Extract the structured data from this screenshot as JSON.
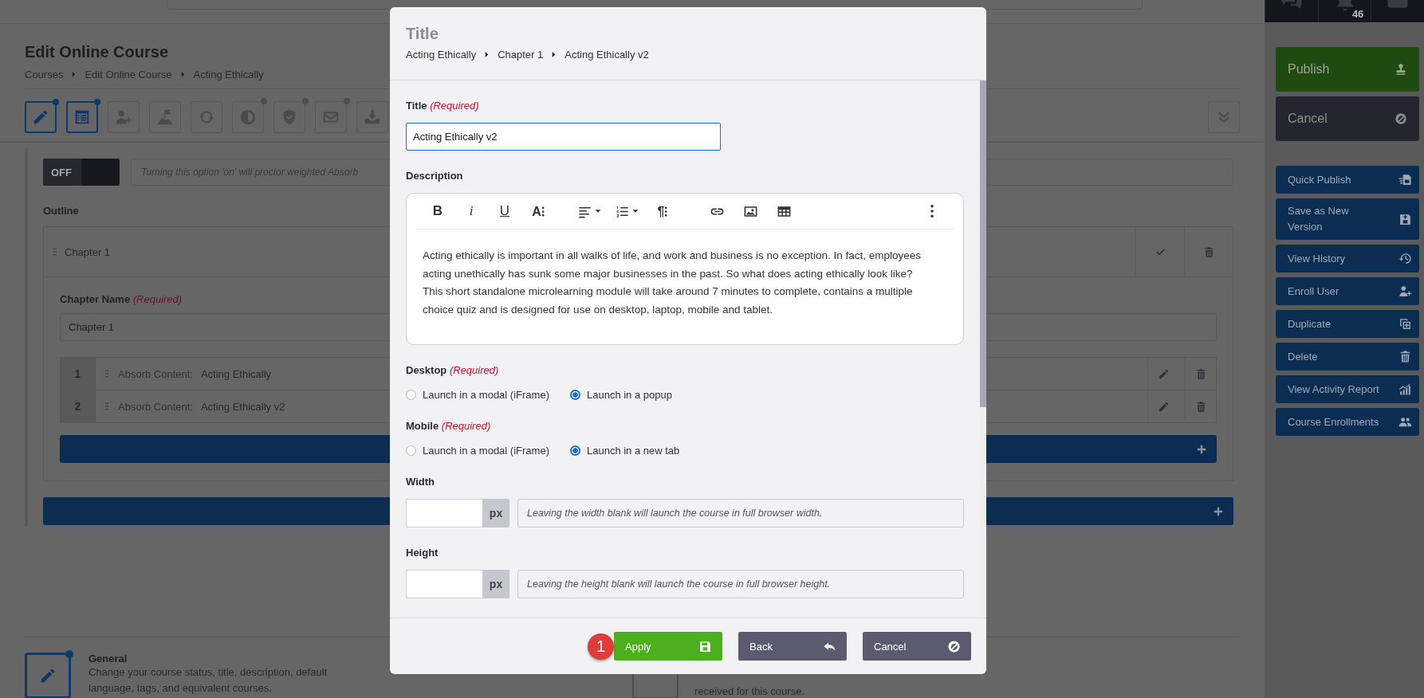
{
  "top_bar": {
    "count": "46"
  },
  "page": {
    "title": "Edit Online Course",
    "breadcrumb": [
      "Courses",
      "Edit Online Course",
      "Acting Ethically"
    ]
  },
  "toolbar": [
    {
      "selected": true,
      "dot": true
    },
    {
      "selected": true,
      "dot": true
    },
    {
      "selected": false,
      "dot": false
    },
    {
      "selected": false,
      "dot": false
    },
    {
      "selected": false,
      "dot": false
    },
    {
      "selected": false,
      "dot": true
    },
    {
      "selected": false,
      "dot": true
    },
    {
      "selected": false,
      "dot": true
    },
    {
      "selected": false,
      "dot": false
    }
  ],
  "proctor": {
    "on": false,
    "label": "OFF",
    "hint": "Turning this option 'on' will proctor weighted Absorb"
  },
  "outline": {
    "label": "Outline",
    "chapters": [
      {
        "name": "Chapter 1",
        "expanded": true,
        "name_label": "Chapter Name",
        "required": "(Required)",
        "name_value": "Chapter 1",
        "items": [
          {
            "number": "1",
            "type": "Absorb Content:",
            "title": "Acting Ethically"
          },
          {
            "number": "2",
            "type": "Absorb Content:",
            "title": "Acting Ethically v2"
          }
        ]
      }
    ]
  },
  "general": {
    "title": "General",
    "description": "Change your course status, title, description, default language, tags, and equivalent courses.",
    "dot": true
  },
  "notifications": {
    "description": "received for this course."
  },
  "sidebar": {
    "primary": [
      {
        "label": "Publish",
        "kind": "publish"
      },
      {
        "label": "Cancel",
        "kind": "cancel"
      }
    ],
    "actions": [
      "Quick Publish",
      "Save as New Version",
      "View History",
      "Enroll User",
      "Duplicate",
      "Delete",
      "View Activity Report",
      "Course Enrollments"
    ]
  },
  "modal": {
    "title": "Title",
    "breadcrumb": [
      "Acting Ethically",
      "Chapter 1",
      "Acting Ethically v2"
    ],
    "title_field": {
      "label": "Title",
      "required": "(Required)",
      "value": "Acting Ethically v2"
    },
    "description": {
      "label": "Description",
      "toolbar": [
        {
          "kind": "bold",
          "glyph": "B"
        },
        {
          "kind": "italic",
          "glyph": "i"
        },
        {
          "kind": "underline",
          "glyph": "U"
        },
        {
          "kind": "font-size",
          "glyph": "A⁝"
        },
        {
          "kind": "align",
          "dropdown": true
        },
        {
          "kind": "ordered-list",
          "dropdown": true
        },
        {
          "kind": "paragraph",
          "glyph": "¶⁝"
        },
        {
          "kind": "link"
        },
        {
          "kind": "image"
        },
        {
          "kind": "table"
        },
        {
          "kind": "more"
        }
      ],
      "text": "Acting ethically is important in all walks of life, and work and business is no exception. In fact, employees acting unethically has sunk some major businesses in the past. So what does acting ethically look like? This short standalone microlearning module will take around 7 minutes to complete, contains a multiple choice quiz and is designed for use on desktop, laptop, mobile and tablet."
    },
    "desktop": {
      "label": "Desktop",
      "required": "(Required)",
      "options": [
        {
          "label": "Launch in a modal (iFrame)",
          "selected": false
        },
        {
          "label": "Launch in a popup",
          "selected": true
        }
      ]
    },
    "mobile": {
      "label": "Mobile",
      "required": "(Required)",
      "options": [
        {
          "label": "Launch in a modal (iFrame)",
          "selected": false
        },
        {
          "label": "Launch in a new tab",
          "selected": true
        }
      ]
    },
    "width": {
      "label": "Width",
      "unit": "px",
      "hint": "Leaving the width blank will launch the course in full browser width."
    },
    "height": {
      "label": "Height",
      "unit": "px",
      "hint": "Leaving the height blank will launch the course in full browser height."
    },
    "badge": "1",
    "buttons": [
      {
        "label": "Apply",
        "kind": "apply"
      },
      {
        "label": "Back",
        "kind": "back"
      },
      {
        "label": "Cancel",
        "kind": "cancel"
      }
    ]
  }
}
